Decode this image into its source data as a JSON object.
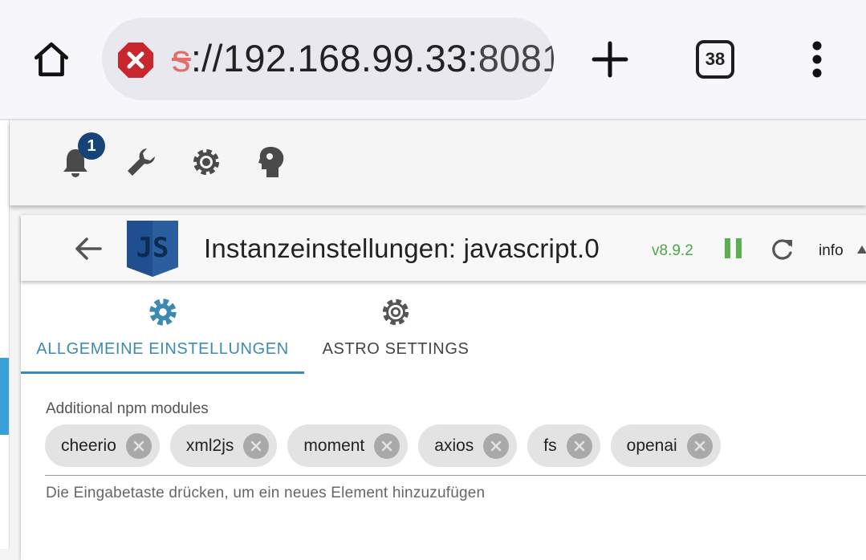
{
  "browser": {
    "url_scheme": "s",
    "url_host": "://192.168.99.33:",
    "url_port": "8081",
    "tab_count": "38",
    "icons": [
      "home-icon",
      "insecure-warning-icon",
      "plus-icon",
      "tabs-icon",
      "more-vert-icon"
    ]
  },
  "toolbar": {
    "notification_count": "1",
    "icons": [
      "bell-icon",
      "wrench-icon",
      "gear-icon",
      "brain-head-icon"
    ]
  },
  "instance": {
    "logo_text": "JS",
    "title": "Instanzeinstellungen:  javascript.0",
    "version": "v8.9.2",
    "info_label": "info"
  },
  "tabs": [
    {
      "label": "ALLGEMEINE EINSTELLUNGEN",
      "active": true,
      "icon": "gear-filled-icon"
    },
    {
      "label": "ASTRO SETTINGS",
      "active": false,
      "icon": "gear-outline-icon"
    }
  ],
  "npm_modules": {
    "label": "Additional npm modules",
    "chips": [
      "cheerio",
      "xml2js",
      "moment",
      "axios",
      "fs",
      "openai"
    ],
    "helper": "Die Eingabetaste drücken, um ein neues Element hinzuzufügen"
  },
  "colors": {
    "accent": "#3c8ab3",
    "badge": "#164477",
    "version_green": "#4ea64a",
    "js_logo": "#1f4f8f",
    "warning_red": "#c8282d"
  }
}
